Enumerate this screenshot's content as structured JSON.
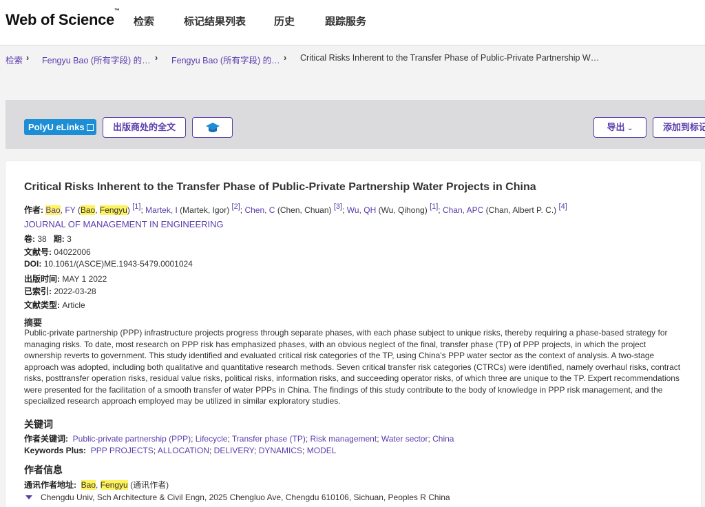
{
  "header": {
    "logo_text": "Web of Science",
    "logo_tm": "™",
    "nav": [
      "检索",
      "标记结果列表",
      "历史",
      "跟踪服务"
    ]
  },
  "breadcrumb": {
    "items": [
      "检索",
      "Fengyu Bao (所有字段) 的…",
      "Fengyu Bao (所有字段) 的…"
    ],
    "current": "Critical Risks Inherent to the Transfer Phase of Public-Private Partnership W…"
  },
  "actions": {
    "polyu": "PolyU eLinks",
    "fulltext": "出版商处的全文",
    "export": "导出",
    "add_marked": "添加到标记"
  },
  "record": {
    "title": "Critical Risks Inherent to the Transfer Phase of Public-Private Partnership Water Projects in China",
    "authors_label": "作者:",
    "authors": [
      {
        "short_prefix": "",
        "short_hl": "Bao",
        "short_suffix": ", FY",
        "full_open": " (",
        "full_hl1": "Bao",
        "full_mid": ", ",
        "full_hl2": "Fengyu",
        "full_close": ")",
        "ref": "[1]"
      },
      {
        "short": "Martek, I",
        "full": " (Martek, Igor)",
        "ref": "[2]"
      },
      {
        "short": "Chen, C",
        "full": " (Chen, Chuan)",
        "ref": "[3]"
      },
      {
        "short": "Wu, QH",
        "full": " (Wu, Qihong)",
        "ref": "[1]"
      },
      {
        "short": "Chan, APC",
        "full": " (Chan, Albert P. C.)",
        "ref": "[4]"
      }
    ],
    "journal": "JOURNAL OF MANAGEMENT IN ENGINEERING",
    "volume_label": "卷:",
    "volume": "38",
    "issue_label": "期:",
    "issue": "3",
    "article_no_label": "文献号:",
    "article_no": "04022006",
    "doi_label": "DOI:",
    "doi": "10.1061/(ASCE)ME.1943-5479.0001024",
    "pub_date_label": "出版时间:",
    "pub_date": "MAY 1 2022",
    "indexed_label": "已索引:",
    "indexed": "2022-03-28",
    "doc_type_label": "文献类型:",
    "doc_type": "Article",
    "abstract_label": "摘要",
    "abstract": "Public-private partnership (PPP) infrastructure projects progress through separate phases, with each phase subject to unique risks, thereby requiring a phase-based strategy for managing risks. To date, most research on PPP risk has emphasized phases, with an obvious neglect of the final, transfer phase (TP) of PPP projects, in which the project ownership reverts to government. This study identified and evaluated critical risk categories of the TP, using China's PPP water sector as the context of analysis. A two-stage approach was adopted, including both qualitative and quantitative research methods. Seven critical transfer risk categories (CTRCs) were identified, namely overhaul risks, contract risks, posttransfer operation risks, residual value risks, political risks, information risks, and succeeding operator risks, of which three are unique to the TP. Expert recommendations were presented for the facilitation of a smooth transfer of water PPPs in China. The findings of this study contribute to the body of knowledge in PPP risk management, and the specialized research approach employed may be utilized in similar exploratory studies.",
    "keywords_label": "关键词",
    "author_kw_label": "作者关键词:",
    "author_keywords": [
      "Public-private partnership (PPP)",
      "Lifecycle",
      "Transfer phase (TP)",
      "Risk management",
      "Water sector",
      "China"
    ],
    "kw_plus_label": "Keywords Plus:",
    "keywords_plus": [
      "PPP PROJECTS",
      "ALLOCATION",
      "DELIVERY",
      "DYNAMICS",
      "MODEL"
    ],
    "author_info_label": "作者信息",
    "corr_label": "通讯作者地址:",
    "corr_hl1": "Bao",
    "corr_sep": ", ",
    "corr_hl2": "Fengyu",
    "corr_note": " (通讯作者)",
    "corr_address": "Chengdu Univ, Sch Architecture & Civil Engn, 2025 Chengluo Ave, Chengdu 610106, Sichuan, Peoples R China",
    "separator": "; "
  }
}
